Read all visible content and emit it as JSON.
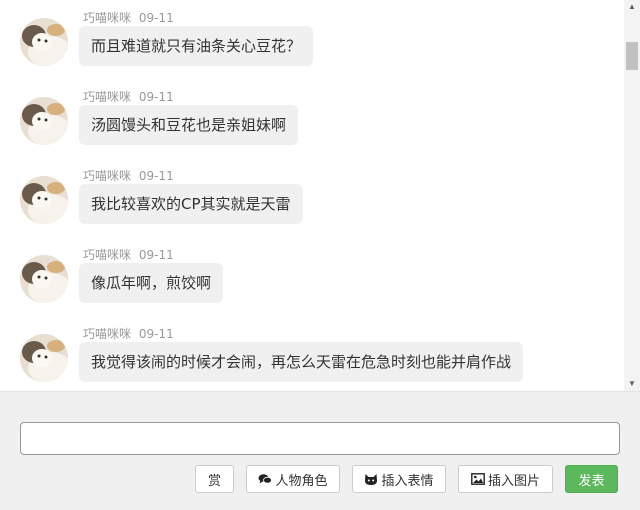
{
  "messages": [
    {
      "user": "巧喵咪咪",
      "time": "09-11",
      "text": "而且难道就只有油条关心豆花？"
    },
    {
      "user": "巧喵咪咪",
      "time": "09-11",
      "text": "汤圆馒头和豆花也是亲姐妹啊"
    },
    {
      "user": "巧喵咪咪",
      "time": "09-11",
      "text": "我比较喜欢的CP其实就是天雷"
    },
    {
      "user": "巧喵咪咪",
      "time": "09-11",
      "text": "像瓜年啊，煎饺啊"
    },
    {
      "user": "巧喵咪咪",
      "time": "09-11",
      "text": "我觉得该闹的时候才会闹，再怎么天雷在危急时刻也能并肩作战"
    }
  ],
  "composer": {
    "input_value": "",
    "reward_label": "赏",
    "character_label": "人物角色",
    "emoji_label": "插入表情",
    "image_label": "插入图片",
    "send_label": "发表"
  },
  "icons": {
    "character": "chat-bubbles-icon",
    "emoji": "cat-face-icon",
    "image": "picture-icon"
  },
  "colors": {
    "bubble": "#f0f0f0",
    "send_button": "#5cb85c",
    "meta_text": "#999999"
  }
}
